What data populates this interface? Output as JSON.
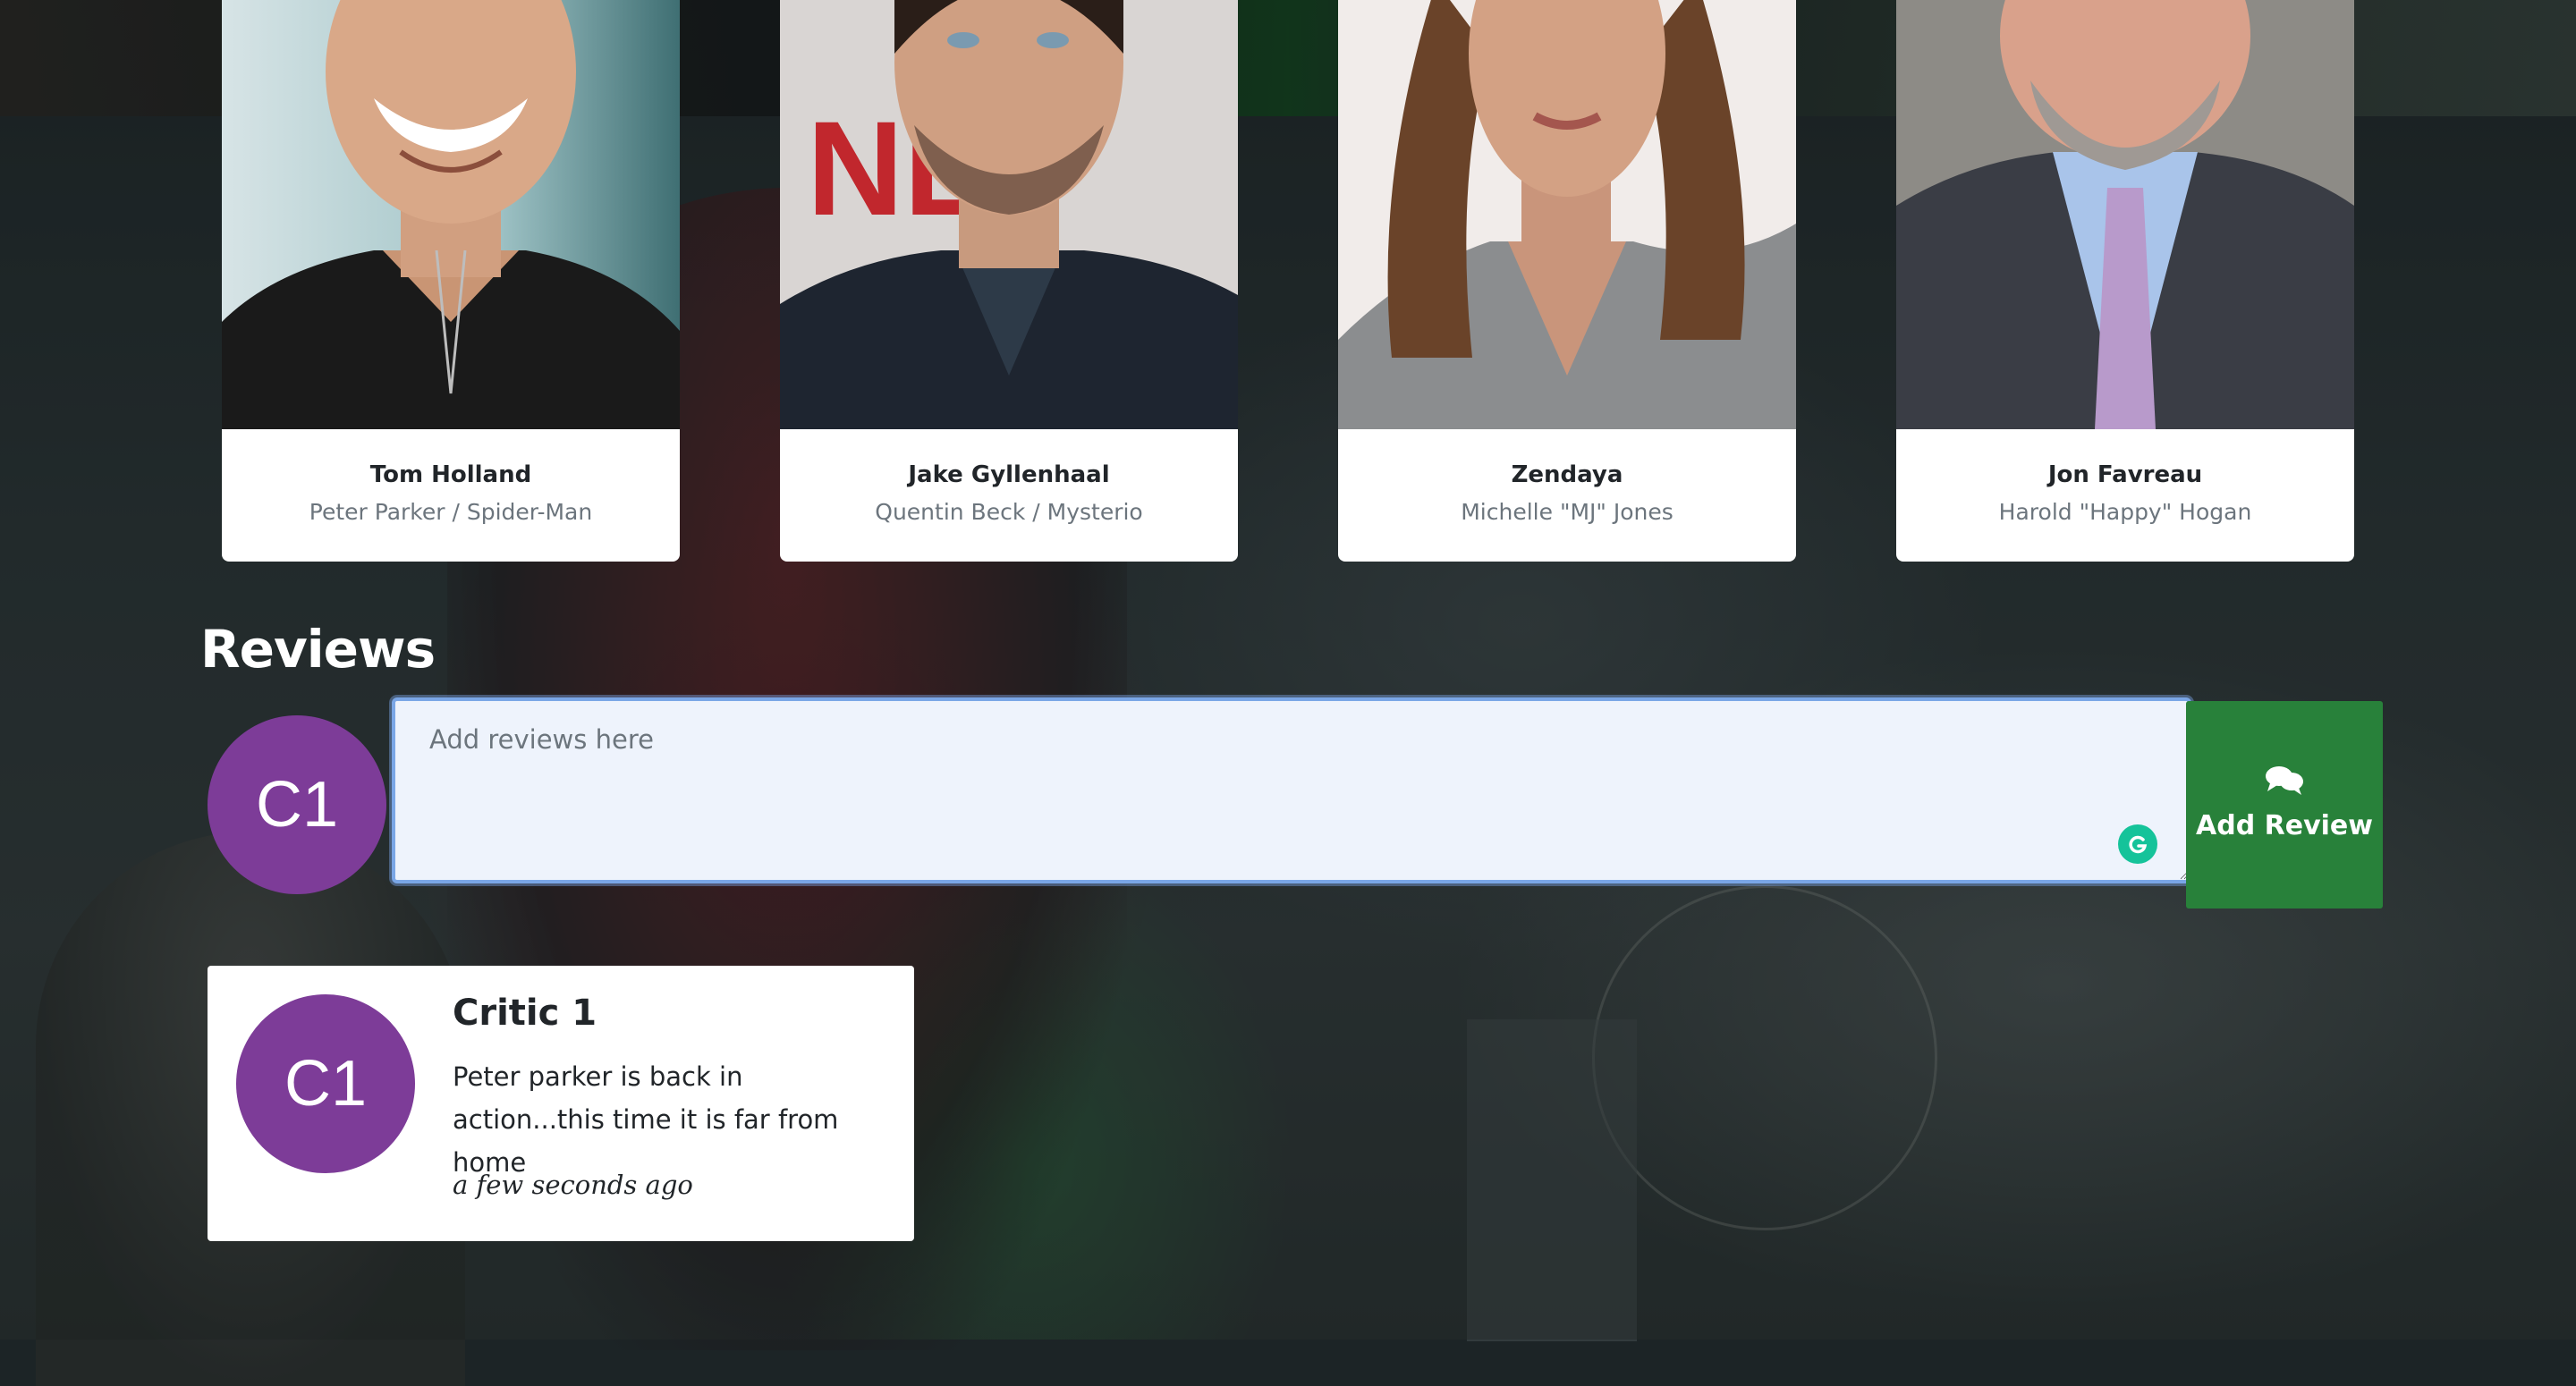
{
  "cast": [
    {
      "name": "Tom Holland",
      "role": "Peter Parker / Spider-Man"
    },
    {
      "name": "Jake Gyllenhaal",
      "role": "Quentin Beck / Mysterio"
    },
    {
      "name": "Zendaya",
      "role": "Michelle \"MJ\" Jones"
    },
    {
      "name": "Jon Favreau",
      "role": "Harold \"Happy\" Hogan"
    }
  ],
  "reviews": {
    "heading": "Reviews",
    "composer": {
      "avatar_initials": "C1",
      "placeholder": "Add reviews here",
      "submit_label": "Add Review",
      "submit_icon": "comments-icon",
      "assistant_icon": "grammarly-icon"
    },
    "items": [
      {
        "avatar_initials": "C1",
        "author": "Critic 1",
        "text": "Peter parker is back in action...this time it is far from home",
        "time": "a few seconds ago"
      }
    ]
  },
  "colors": {
    "avatar": "#7d3c98",
    "submit_button": "#28813a",
    "input_background": "#eef3fc",
    "input_border": "#7aa6e6",
    "grammarly": "#15c39a"
  }
}
